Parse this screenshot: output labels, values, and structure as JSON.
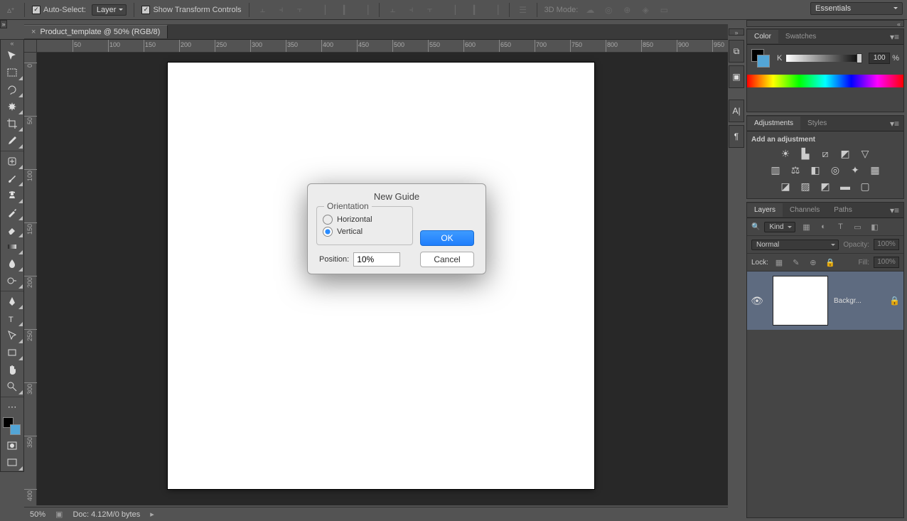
{
  "optionsBar": {
    "autoSelectLabel": "Auto-Select:",
    "autoSelectDropdown": "Layer",
    "showTransformLabel": "Show Transform Controls",
    "modeLabel": "3D Mode:"
  },
  "workspaceSelector": "Essentials",
  "documentTab": {
    "title": "Product_template @ 50% (RGB/8)"
  },
  "hruler": {
    "ticks": [
      50,
      100,
      150,
      200,
      250,
      300,
      350,
      400,
      450,
      500,
      550,
      600,
      650,
      700,
      750,
      800,
      850,
      900,
      950
    ]
  },
  "vruler": {
    "ticks": [
      0,
      50,
      100,
      150,
      200,
      250,
      300,
      350,
      400
    ]
  },
  "statusBar": {
    "zoom": "50%",
    "doc": "Doc: 4.12M/0 bytes"
  },
  "leftCollapse": {
    "chev": "»"
  },
  "colorPanel": {
    "tabs": {
      "color": "Color",
      "swatches": "Swatches"
    },
    "kLabel": "K",
    "kValue": "100",
    "pct": "%"
  },
  "adjPanel": {
    "tabs": {
      "adjustments": "Adjustments",
      "styles": "Styles"
    },
    "heading": "Add an adjustment"
  },
  "layersPanel": {
    "tabs": {
      "layers": "Layers",
      "channels": "Channels",
      "paths": "Paths"
    },
    "kindLabel": "Kind",
    "filterIcons": [
      "▦",
      "◐",
      "T",
      "▭",
      "◧"
    ],
    "blend": "Normal",
    "opacityLabel": "Opacity:",
    "opacityVal": "100%",
    "lockLabel": "Lock:",
    "fillLabel": "Fill:",
    "fillVal": "100%",
    "lockIcons": [
      "▦",
      "✎",
      "⊕",
      "🔒"
    ],
    "layers": [
      {
        "name": "Backgr...",
        "locked": true
      }
    ]
  },
  "iconStrip": {
    "icons": [
      "⧉",
      "▣",
      "A|",
      "¶"
    ]
  },
  "dialog": {
    "title": "New Guide",
    "orientationLabel": "Orientation",
    "horizontal": "Horizontal",
    "vertical": "Vertical",
    "positionLabel": "Position:",
    "positionValue": "10%",
    "ok": "OK",
    "cancel": "Cancel"
  },
  "toolIcons": [
    "move",
    "marquee",
    "lasso",
    "wand",
    "crop",
    "eyedrop",
    "heal",
    "brush",
    "stamp",
    "history",
    "eraser",
    "gradient",
    "blur",
    "dodge",
    "pen",
    "type",
    "path",
    "shape",
    "hand",
    "zoom"
  ]
}
